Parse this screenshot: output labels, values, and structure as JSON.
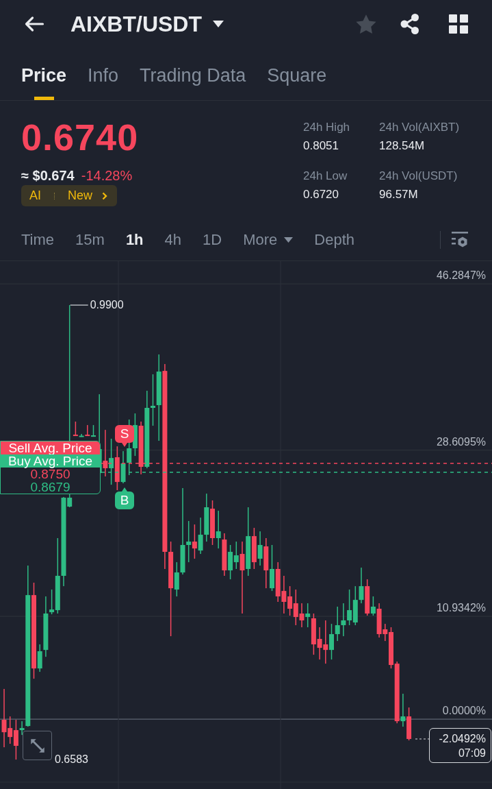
{
  "header": {
    "title": "AIXBT/USDT",
    "favorite": false
  },
  "tabs": [
    {
      "label": "Price",
      "selected": true
    },
    {
      "label": "Info",
      "selected": false
    },
    {
      "label": "Trading Data",
      "selected": false
    },
    {
      "label": "Square",
      "selected": false
    }
  ],
  "ticker": {
    "last_price": "0.6740",
    "falling": true,
    "fiat_price": "≈ $0.674",
    "change": "-14.28%",
    "badge": {
      "label": "AI",
      "action": "New"
    }
  },
  "stats": [
    {
      "label": "24h High",
      "value": "0.8051"
    },
    {
      "label": "24h Vol(AIXBT)",
      "value": "128.54M"
    },
    {
      "label": "24h Low",
      "value": "0.6720"
    },
    {
      "label": "24h Vol(USDT)",
      "value": "96.57M"
    }
  ],
  "intervals": [
    {
      "label": "Time",
      "kind": "option",
      "selected": false
    },
    {
      "label": "15m",
      "kind": "option",
      "selected": false
    },
    {
      "label": "1h",
      "kind": "option",
      "selected": true
    },
    {
      "label": "4h",
      "kind": "option",
      "selected": false
    },
    {
      "label": "1D",
      "kind": "option",
      "selected": false
    },
    {
      "label": "More",
      "kind": "dropdown",
      "selected": false
    },
    {
      "label": "Depth",
      "kind": "option",
      "selected": false
    }
  ],
  "chart": {
    "chart_data": {
      "type": "candlestick",
      "grid": true,
      "ohlc": [
        [
          -0.07,
          3.21,
          -2.99,
          -1.39
        ],
        [
          -0.95,
          0.29,
          -2.62,
          -1.9
        ],
        [
          -1.17,
          -0.07,
          -4.3,
          -2.84
        ],
        [
          -1.17,
          -0.22,
          -1.68,
          -0.95
        ],
        [
          -0.73,
          16.33,
          -0.8,
          13.19
        ],
        [
          13.19,
          14.51,
          4.3,
          5.39
        ],
        [
          5.39,
          7.95,
          5.03,
          7.22
        ],
        [
          7.36,
          13.05,
          6.63,
          11.23
        ],
        [
          11.37,
          13.78,
          11.15,
          11.66
        ],
        [
          11.59,
          19.25,
          11.23,
          15.24
        ],
        [
          15.24,
          23.62,
          14.14,
          23.55
        ],
        [
          22.6,
          44.03,
          22.53,
          23.55
        ],
        [
          30.25,
          31.64,
          30.11,
          30.11
        ],
        [
          30.03,
          30.33,
          30.03,
          30.14
        ],
        [
          30.25,
          31.27,
          30.11,
          30.11
        ],
        [
          30.03,
          31.27,
          30.03,
          30.18
        ],
        [
          26.17,
          34.55,
          25.44,
          28.72
        ],
        [
          27.48,
          30.76,
          25.81,
          26.68
        ],
        [
          26.68,
          29.82,
          24.93,
          27.77
        ],
        [
          27.85,
          29.01,
          24.35,
          25.22
        ],
        [
          25.22,
          28.5,
          25.08,
          27.19
        ],
        [
          27.26,
          31.86,
          25.95,
          28.8
        ],
        [
          28.8,
          32.51,
          27.99,
          31.27
        ],
        [
          31.2,
          31.64,
          26.03,
          26.83
        ],
        [
          26.83,
          34.92,
          26.68,
          33.1
        ],
        [
          33.1,
          36.67,
          31.2,
          33.32
        ],
        [
          33.39,
          38.78,
          29.6,
          36.96
        ],
        [
          37.03,
          37.76,
          15.97,
          17.79
        ],
        [
          17.79,
          18.88,
          8.82,
          13.92
        ],
        [
          13.78,
          16.69,
          13.05,
          15.6
        ],
        [
          15.6,
          24.57,
          15.38,
          18.52
        ],
        [
          18.52,
          21.07,
          16.69,
          18.88
        ],
        [
          18.88,
          20.7,
          17.06,
          18.15
        ],
        [
          17.93,
          21.43,
          17.57,
          19.61
        ],
        [
          19.61,
          23.98,
          18.88,
          22.53
        ],
        [
          22.38,
          23.26,
          18.52,
          19.25
        ],
        [
          19.25,
          22.16,
          18.15,
          19.97
        ],
        [
          19.1,
          19.76,
          15.24,
          15.82
        ],
        [
          15.82,
          18.52,
          14.87,
          17.79
        ],
        [
          16.69,
          18.88,
          15.97,
          17.42
        ],
        [
          17.57,
          18.88,
          11.23,
          15.82
        ],
        [
          15.97,
          22.53,
          15.24,
          19.46
        ],
        [
          19.46,
          20.34,
          15.97,
          16.69
        ],
        [
          17.06,
          19.97,
          16.33,
          18.52
        ],
        [
          18.37,
          19.25,
          13.92,
          15.82
        ],
        [
          13.92,
          18.52,
          13.63,
          15.97
        ],
        [
          15.97,
          16.69,
          12.47,
          13.05
        ],
        [
          13.63,
          15.24,
          11.23,
          12.47
        ],
        [
          13.05,
          14.14,
          11.01,
          11.74
        ],
        [
          12.32,
          13.78,
          9.99,
          10.86
        ],
        [
          11.23,
          12.32,
          9.77,
          10.5
        ],
        [
          10.86,
          12.32,
          9.77,
          11.23
        ],
        [
          10.72,
          11.23,
          6.85,
          7.95
        ],
        [
          8.53,
          9.77,
          6.34,
          7.58
        ],
        [
          7.95,
          10.5,
          5.9,
          7.36
        ],
        [
          7.36,
          10.13,
          6.34,
          9.04
        ],
        [
          9.04,
          11.96,
          8.31,
          9.99
        ],
        [
          9.99,
          12.32,
          8.82,
          10.5
        ],
        [
          10.5,
          13.78,
          9.99,
          11.59
        ],
        [
          10.28,
          14.14,
          9.99,
          12.68
        ],
        [
          12.68,
          16.11,
          12.32,
          14.14
        ],
        [
          14.14,
          14.87,
          11.01,
          11.23
        ],
        [
          11.23,
          13.05,
          11.01,
          11.96
        ],
        [
          11.74,
          12.32,
          8.68,
          9.04
        ],
        [
          9.55,
          10.13,
          8.31,
          9.04
        ],
        [
          9.26,
          9.77,
          5.39,
          5.76
        ],
        [
          5.9,
          6.12,
          -0.44,
          -0.22
        ],
        [
          -0.22,
          2.7,
          -0.8,
          0.29
        ],
        [
          0.29,
          1.24,
          -2.26,
          -2.11
        ]
      ],
      "ylim": [
        -7.43,
        48.7
      ],
      "yticks": [
        {
          "value": 46.2847,
          "label": "46.2847%"
        },
        {
          "value": 28.6095,
          "label": "28.6095%"
        },
        {
          "value": 10.9342,
          "label": "10.9342%"
        },
        {
          "value": 0,
          "label": "0.0000%"
        }
      ]
    },
    "high_label": "0.9900",
    "low_label": "0.6583",
    "avg_prices": [
      {
        "label": "Sell Avg. Price",
        "value": "0.8750",
        "kind": "sell"
      },
      {
        "label": "Buy Avg. Price",
        "value": "0.8679",
        "kind": "buy"
      }
    ],
    "trade_markers": [
      {
        "label": "S",
        "kind": "sell"
      },
      {
        "label": "B",
        "kind": "buy"
      }
    ],
    "last_price": {
      "change": "-2.0492%",
      "countdown": "07:09"
    }
  }
}
